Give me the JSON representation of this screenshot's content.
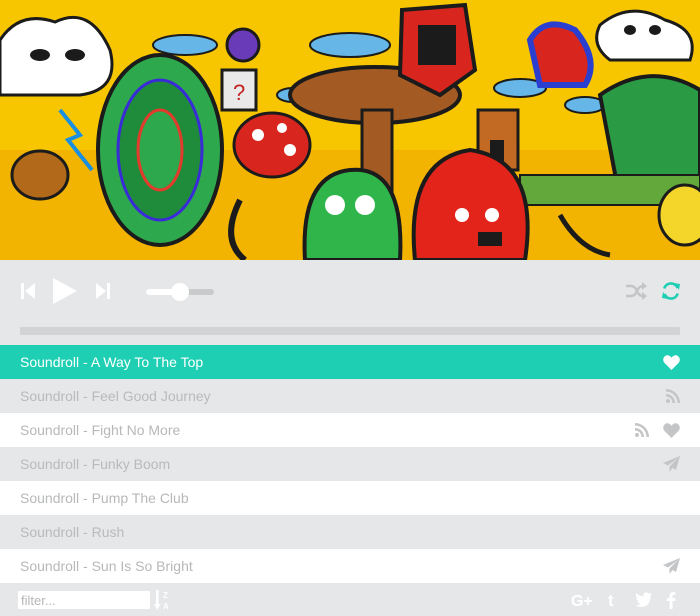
{
  "player": {
    "volume_level": 0.5,
    "progress_level": 0,
    "colors": {
      "accent": "#1fcfb3",
      "icon": "#ffffff",
      "muted_icon": "#c4c5c7",
      "background": "#e6e7e9"
    }
  },
  "controls": {
    "prev_icon": "skip-back-icon",
    "play_icon": "play-icon",
    "next_icon": "skip-forward-icon",
    "shuffle_icon": "shuffle-icon",
    "repeat_icon": "repeat-icon"
  },
  "playlist": {
    "tracks": [
      {
        "title": "Soundroll - A Way To The Top",
        "icons": [
          "heart-icon"
        ]
      },
      {
        "title": "Soundroll - Feel Good Journey",
        "icons": [
          "rss-icon"
        ]
      },
      {
        "title": "Soundroll - Fight No More",
        "icons": [
          "rss-icon",
          "heart-icon"
        ]
      },
      {
        "title": "Soundroll - Funky Boom",
        "icons": [
          "send-icon"
        ]
      },
      {
        "title": "Soundroll - Pump The Club",
        "icons": []
      },
      {
        "title": "Soundroll - Rush",
        "icons": []
      },
      {
        "title": "Soundroll - Sun Is So Bright",
        "icons": [
          "send-icon"
        ]
      }
    ]
  },
  "footer": {
    "filter_placeholder": "filter...",
    "filter_value": "",
    "sort_icon": "sort-alpha-icon",
    "social": [
      "google-plus-icon",
      "tumblr-icon",
      "twitter-icon",
      "facebook-icon"
    ]
  }
}
